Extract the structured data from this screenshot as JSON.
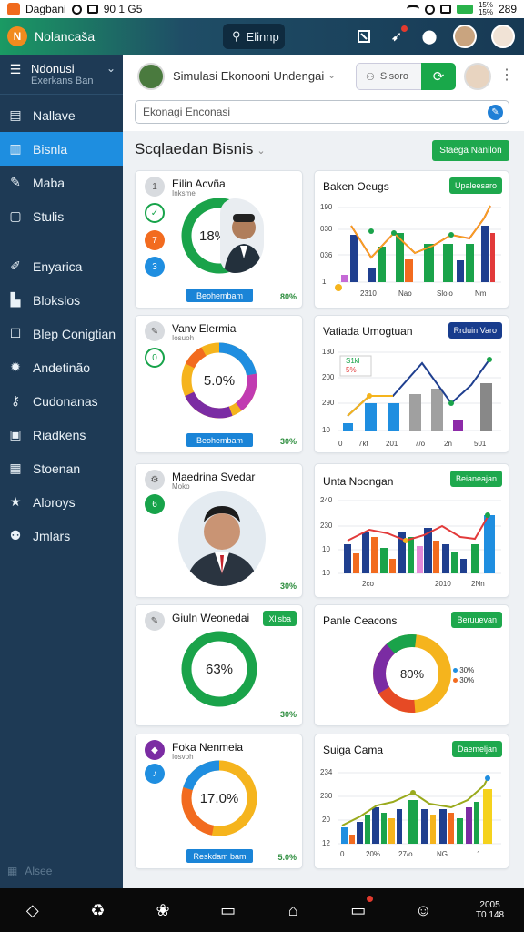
{
  "status": {
    "carrier": "Dagbani",
    "time": "90 1 G5",
    "battery": "289",
    "signal": "15%\n15%"
  },
  "app": {
    "title": "Nolancaša",
    "logo": "N",
    "search_label": "Elinnp",
    "accent": "#1e8ee0",
    "brand_green": "#1ea84d"
  },
  "header_icons": [
    "flag-icon",
    "pin-icon",
    "bell-icon"
  ],
  "sidebar": {
    "account_name": "Ndonusi",
    "account_sub": "Exerkans Ban",
    "items": [
      {
        "label": "Nallave",
        "icon": "layout-icon"
      },
      {
        "label": "Bisnla",
        "icon": "chart-icon",
        "active": true
      },
      {
        "label": "Maba",
        "icon": "tool-icon"
      },
      {
        "label": "Stulis",
        "icon": "document-icon"
      },
      {
        "label": "Enyarica",
        "icon": "pencil-icon"
      },
      {
        "label": "Blokslos",
        "icon": "building-icon"
      },
      {
        "label": "Blep Conigtian",
        "icon": "square-icon"
      },
      {
        "label": "Andetinão",
        "icon": "sun-icon"
      },
      {
        "label": "Cudonanas",
        "icon": "key-icon"
      },
      {
        "label": "Riadkens",
        "icon": "id-icon"
      },
      {
        "label": "Stoenan",
        "icon": "book-icon"
      },
      {
        "label": "Aloroys",
        "icon": "star-icon"
      },
      {
        "label": "Jmlars",
        "icon": "users-icon"
      }
    ],
    "bottom_label": "Alsee"
  },
  "content": {
    "title": "Simulasi Ekonooni Undengai",
    "user_label": "Sisoro",
    "search_value": "Ekonagi Enconasi",
    "section_title": "Scqlaedan Bisnis",
    "section_button": "Staega Nanilon"
  },
  "left_cards": [
    {
      "title": "Eilin Acvña",
      "subtitle": "Inksme",
      "center": "18%",
      "button": "Beohembam",
      "pct": "80%",
      "chips": [
        "1",
        "✓",
        "7",
        "3"
      ]
    },
    {
      "title": "Vanv Elermia",
      "subtitle": "Iosuoh",
      "center": "5.0%",
      "button": "Beohembam",
      "pct": "30%",
      "chips": [
        "✎",
        "0"
      ]
    },
    {
      "title": "Maedrina Svedar",
      "subtitle": "Moko",
      "pct": "30%",
      "chips": [
        "⚙",
        "6"
      ]
    },
    {
      "title": "Giuln Weonedai",
      "center": "63%",
      "button": "Xlisba",
      "pct": "30%",
      "chips": [
        "✎"
      ]
    },
    {
      "title": "Foka Nenmeia",
      "subtitle": "Iosvoh",
      "center": "17.0%",
      "button": "Reskdam bam",
      "pct": "5.0%",
      "chips": [
        "◆",
        "♪"
      ]
    }
  ],
  "right_cards": [
    {
      "title": "Baken Oeugs",
      "button": "Upaleesaro",
      "yticks": [
        "190",
        "030",
        "036",
        "1"
      ],
      "xticks": [
        "2310",
        "Nao",
        "Slolo",
        "Nm"
      ]
    },
    {
      "title": "Vatiada Umogtuan",
      "button": "Rrduin Varo",
      "badge_top": "S1kl",
      "badge_pct": "5%",
      "yticks": [
        "130",
        "200",
        "290",
        "10"
      ],
      "xticks": [
        "0",
        "7kt",
        "201",
        "7/o",
        "2n",
        "501"
      ]
    },
    {
      "title": "Unta Noongan",
      "button": "Beianeajan",
      "yticks": [
        "240",
        "230",
        "10",
        "10"
      ],
      "xticks": [
        "2co",
        "2010",
        "2Nn"
      ]
    },
    {
      "title": "Panle Ceacons",
      "button": "Beruuevan",
      "center": "80%",
      "legend": [
        "30%",
        "30%"
      ]
    },
    {
      "title": "Suiga Cama",
      "button": "Daemeljan",
      "yticks": [
        "234",
        "230",
        "20",
        "12"
      ],
      "xticks": [
        "0",
        "20%",
        "27/o",
        "NG",
        "1"
      ]
    }
  ],
  "bottom_nav": {
    "time": "2005\nT0 148"
  }
}
